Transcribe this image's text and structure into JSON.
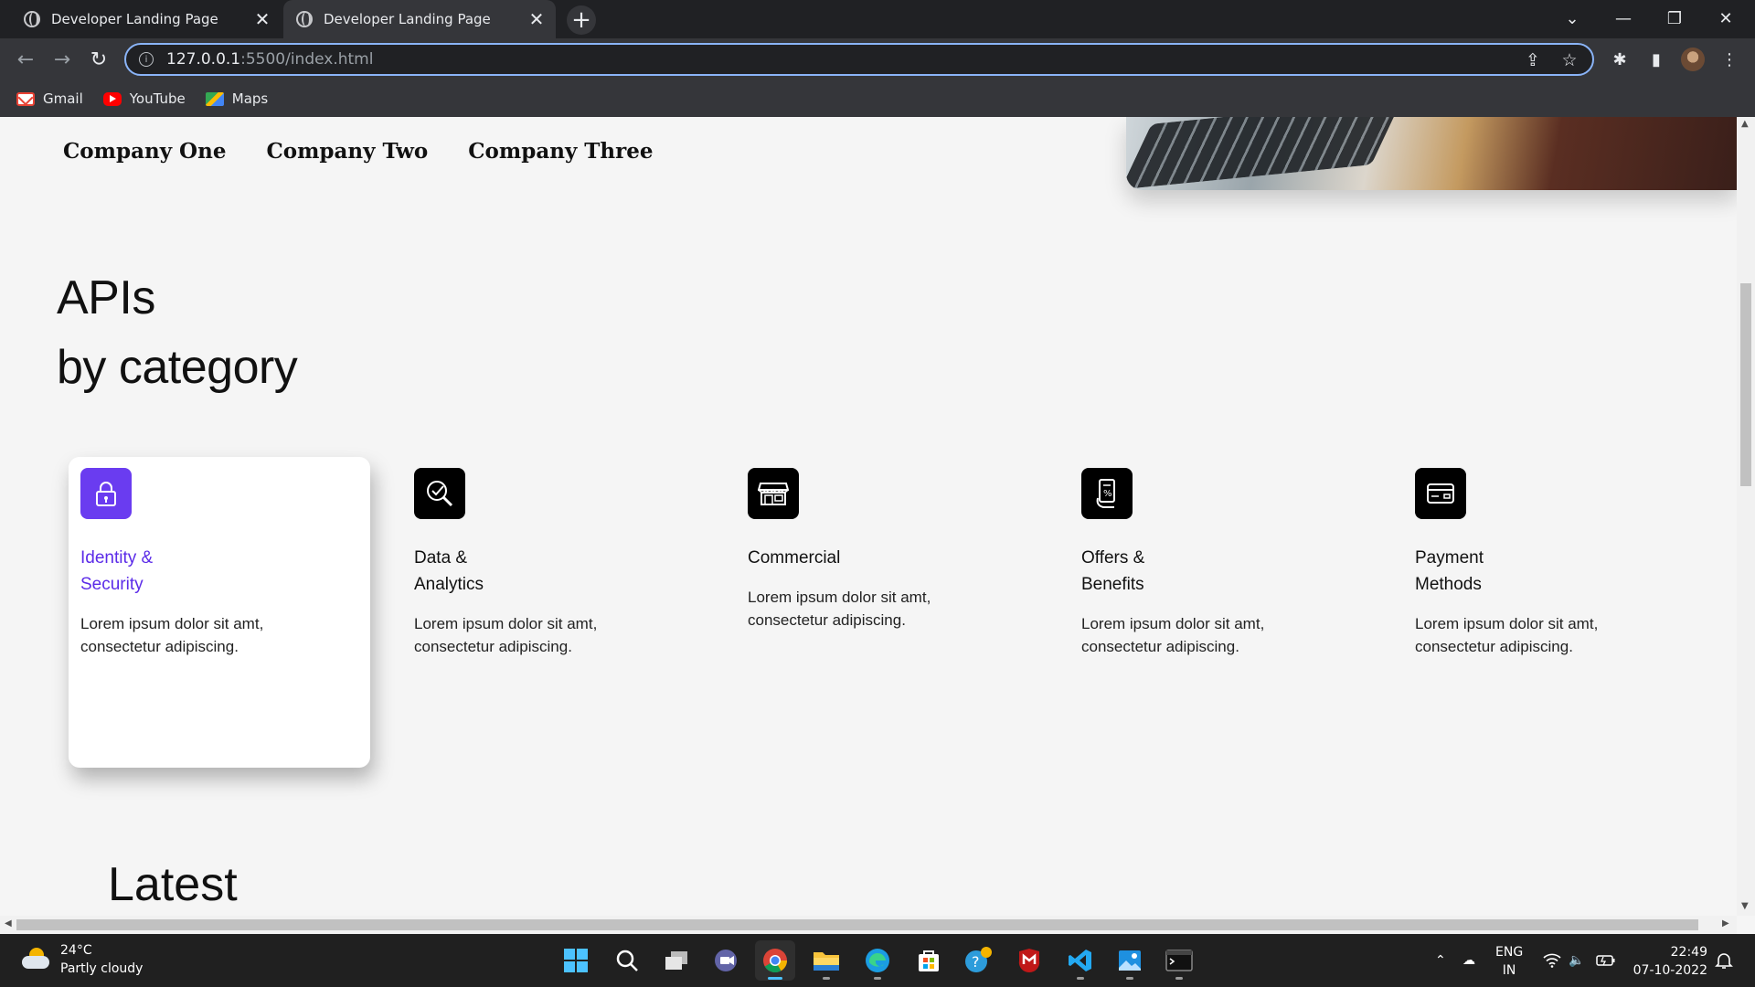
{
  "browser": {
    "tabs": [
      {
        "title": "Developer Landing Page",
        "active": false
      },
      {
        "title": "Developer Landing Page",
        "active": true
      }
    ],
    "url_host": "127.0.0.1",
    "url_path": ":5500/index.html",
    "bookmarks": [
      {
        "label": "Gmail",
        "icon": "gmail-icon"
      },
      {
        "label": "YouTube",
        "icon": "youtube-icon"
      },
      {
        "label": "Maps",
        "icon": "maps-icon"
      }
    ]
  },
  "page": {
    "companies": [
      "Company One",
      "Company Two",
      "Company Three"
    ],
    "apis_title_line1": "APIs",
    "apis_title_line2": "by category",
    "accent_color": "#5b2be8",
    "categories": [
      {
        "title_line1": "Identity &",
        "title_line2": "Security",
        "description": "Lorem ipsum dolor sit amt, consectetur adipiscing.",
        "icon": "lock-icon",
        "selected": true
      },
      {
        "title_line1": "Data &",
        "title_line2": "Analytics",
        "description": "Lorem ipsum dolor sit amt, consectetur adipiscing.",
        "icon": "analytics-search-icon",
        "selected": false
      },
      {
        "title_line1": "Commercial",
        "title_line2": "",
        "description": "Lorem ipsum dolor sit amt, consectetur adipiscing.",
        "icon": "storefront-icon",
        "selected": false
      },
      {
        "title_line1": "Offers &",
        "title_line2": "Benefits",
        "description": "Lorem ipsum dolor sit amt, consectetur adipiscing.",
        "icon": "coupon-icon",
        "selected": false
      },
      {
        "title_line1": "Payment",
        "title_line2": "Methods",
        "description": "Lorem ipsum dolor sit amt, consectetur adipiscing.",
        "icon": "credit-card-icon",
        "selected": false
      }
    ],
    "latest_title": "Latest"
  },
  "taskbar": {
    "weather_temp": "24°C",
    "weather_desc": "Partly cloudy",
    "lang_line1": "ENG",
    "lang_line2": "IN",
    "time": "22:49",
    "date": "07-10-2022"
  }
}
